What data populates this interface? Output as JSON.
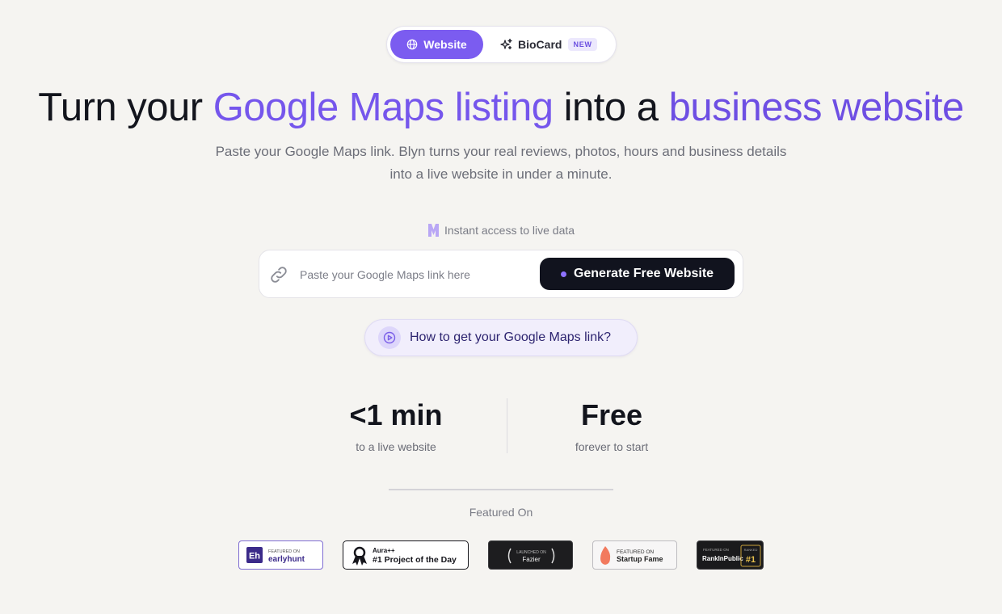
{
  "tabs": {
    "website_label": "Website",
    "biocard_label": "BioCard",
    "new_badge": "NEW"
  },
  "hero": {
    "headline_part1": "Turn your ",
    "headline_accent1": "Google Maps listing",
    "headline_part2": " into a ",
    "headline_accent2": "business website",
    "subtitle_line1": "Paste your Google Maps link. Blyn turns your real reviews, photos, hours and business details",
    "subtitle_line2": "into a live website in under a minute."
  },
  "instant": {
    "text": "Instant access to live data"
  },
  "search": {
    "placeholder": "Paste your Google Maps link here",
    "value": "",
    "button_label": "Generate Free Website"
  },
  "howto": {
    "label": "How to get your Google Maps link?"
  },
  "stats": [
    {
      "value": "<1 min",
      "label": "to a live website"
    },
    {
      "value": "Free",
      "label": "forever to start"
    }
  ],
  "featured": {
    "title": "Featured On",
    "badges": [
      {
        "name": "earlyhunt",
        "logo": "Eh",
        "top": "FEATURED ON",
        "main": "earlyhunt"
      },
      {
        "name": "aura",
        "top": "Aura++",
        "main": "#1 Project of the Day"
      },
      {
        "name": "fazier",
        "top": "LAUNCHED ON",
        "main": "Fazier"
      },
      {
        "name": "startupfame",
        "top": "FEATURED ON",
        "main": "Startup Fame"
      },
      {
        "name": "rankinpublic",
        "top": "FEATURED ON",
        "main": "RankInPublic",
        "rank_top": "RANKED",
        "rank": "#1"
      }
    ]
  },
  "colors": {
    "accent": "#7556ec",
    "button_dark": "#11131e",
    "background": "#f5f4f1"
  }
}
